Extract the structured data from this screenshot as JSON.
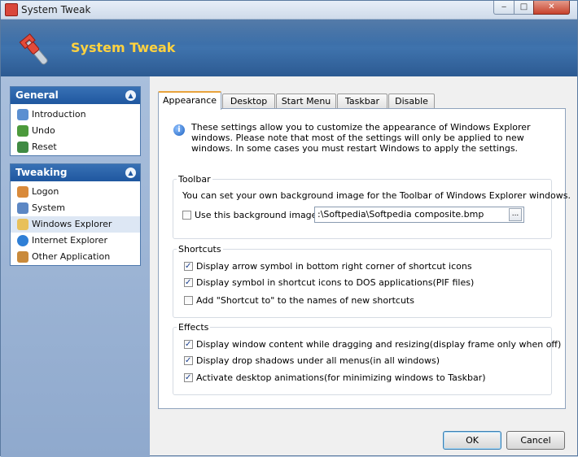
{
  "window": {
    "title": "System Tweak"
  },
  "header": {
    "title": "System Tweak"
  },
  "sidebar": {
    "groups": [
      {
        "title": "General",
        "items": [
          {
            "label": "Introduction",
            "icon": "question-icon"
          },
          {
            "label": "Undo",
            "icon": "undo-icon"
          },
          {
            "label": "Reset",
            "icon": "reset-icon"
          }
        ]
      },
      {
        "title": "Tweaking",
        "items": [
          {
            "label": "Logon",
            "icon": "users-icon"
          },
          {
            "label": "System",
            "icon": "monitor-icon"
          },
          {
            "label": "Windows Explorer",
            "icon": "folder-icon",
            "selected": true
          },
          {
            "label": "Internet Explorer",
            "icon": "ie-icon"
          },
          {
            "label": "Other Application",
            "icon": "box-icon"
          }
        ]
      }
    ]
  },
  "tabs": [
    {
      "label": "Appearance",
      "active": true
    },
    {
      "label": "Desktop"
    },
    {
      "label": "Start Menu"
    },
    {
      "label": "Taskbar"
    },
    {
      "label": "Disable"
    }
  ],
  "intro": "These settings allow you to customize the appearance of Windows Explorer windows. Please note that most of the settings will only be applied to  new windows. In some cases you must restart Windows to apply the settings.",
  "toolbar": {
    "legend": "Toolbar",
    "description": "You can set your own background image for the Toolbar of Windows Explorer windows.",
    "use_bg_label": "Use this background image:",
    "use_bg_checked": false,
    "path_value": ":\\Softpedia\\Softpedia composite.bmp",
    "browse_label": "..."
  },
  "shortcuts": {
    "legend": "Shortcuts",
    "options": [
      {
        "label": "Display arrow symbol in bottom right corner of shortcut icons",
        "checked": true
      },
      {
        "label": "Display symbol in shortcut icons to DOS applications(PIF files)",
        "checked": true
      },
      {
        "label": "Add \"Shortcut to\" to the names of new shortcuts",
        "checked": false
      }
    ]
  },
  "effects": {
    "legend": "Effects",
    "options": [
      {
        "label": "Display window content while dragging and resizing(display frame only when off)",
        "checked": true
      },
      {
        "label": "Display drop shadows under all menus(in all windows)",
        "checked": true
      },
      {
        "label": "Activate desktop animations(for minimizing windows to Taskbar)",
        "checked": true
      }
    ]
  },
  "buttons": {
    "ok": "OK",
    "cancel": "Cancel"
  },
  "colors": {
    "header_bg": "#3f73ad",
    "header_title": "#ffd23f",
    "group_head": "#1f57a0",
    "tab_accent": "#e8a33c"
  }
}
